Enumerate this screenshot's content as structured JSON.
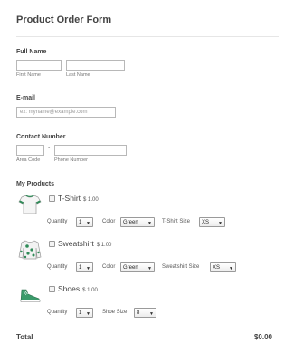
{
  "form": {
    "title": "Product Order Form",
    "full_name": {
      "label": "Full Name",
      "first_sub": "First Name",
      "last_sub": "Last Name"
    },
    "email": {
      "label": "E-mail",
      "placeholder": "ex: myname@example.com"
    },
    "contact": {
      "label": "Contact Number",
      "dash": "-",
      "area_sub": "Area Code",
      "phone_sub": "Phone Number"
    },
    "products_label": "My Products",
    "products": [
      {
        "name": "T-Shirt",
        "price": "$ 1.00",
        "icon": "tshirt-image",
        "options": [
          {
            "label": "Quantity",
            "value": "1"
          },
          {
            "label": "Color",
            "value": "Green"
          },
          {
            "label": "T-Shirt Size",
            "value": "XS"
          }
        ]
      },
      {
        "name": "Sweatshirt",
        "price": "$ 1.00",
        "icon": "sweatshirt-image",
        "options": [
          {
            "label": "Quantity",
            "value": "1"
          },
          {
            "label": "Color",
            "value": "Green"
          },
          {
            "label": "Sweatshirt Size",
            "value": "XS"
          }
        ]
      },
      {
        "name": "Shoes",
        "price": "$ 1.00",
        "icon": "shoes-image",
        "options": [
          {
            "label": "Quantity",
            "value": "1"
          },
          {
            "label": "Shoe Size",
            "value": "8"
          }
        ]
      }
    ],
    "total_label": "Total",
    "total_value": "$0.00",
    "accent_color": "#2e8b57"
  }
}
